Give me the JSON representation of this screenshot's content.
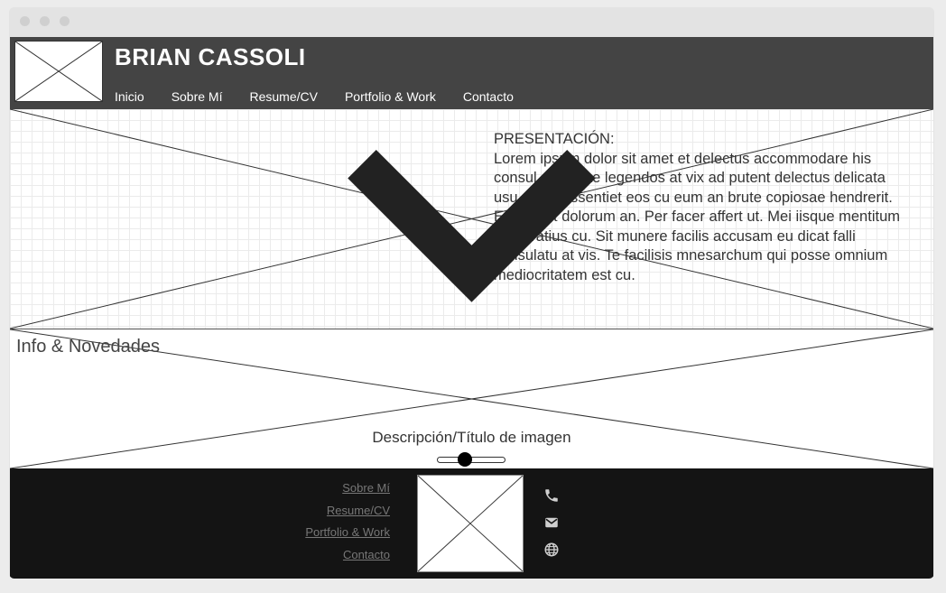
{
  "header": {
    "site_title": "BRIAN CASSOLI",
    "nav": [
      "Inicio",
      "Sobre Mí",
      "Resume/CV",
      "Portfolio & Work",
      "Contacto"
    ]
  },
  "hero": {
    "presentation": "PRESENTACIÓN:\nLorem ipsum dolor sit amet et delectus accommodare his consul copiosae legendos at vix ad putent delectus delicata usu. Vidit dissentiet eos cu eum an brute copiosae hendrerit. Eos erant dolorum an. Per facer affert ut. Mei iisque mentitum moderatius cu. Sit munere facilis accusam eu dicat falli consulatu at vis. Te facilisis mnesarchum qui posse omnium mediocritatem est cu.",
    "scroll_icon": "chevron-down-icon"
  },
  "info": {
    "title": "Info & Novedades",
    "caption": "Descripción/Título de imagen"
  },
  "footer": {
    "links": [
      "Sobre Mí",
      "Resume/CV",
      "Portfolio & Work",
      "Contacto"
    ],
    "icons": [
      "phone-icon",
      "mail-icon",
      "globe-icon"
    ]
  },
  "colors": {
    "header_bg": "#444444",
    "footer_bg": "#141414",
    "footer_link": "#777777"
  }
}
